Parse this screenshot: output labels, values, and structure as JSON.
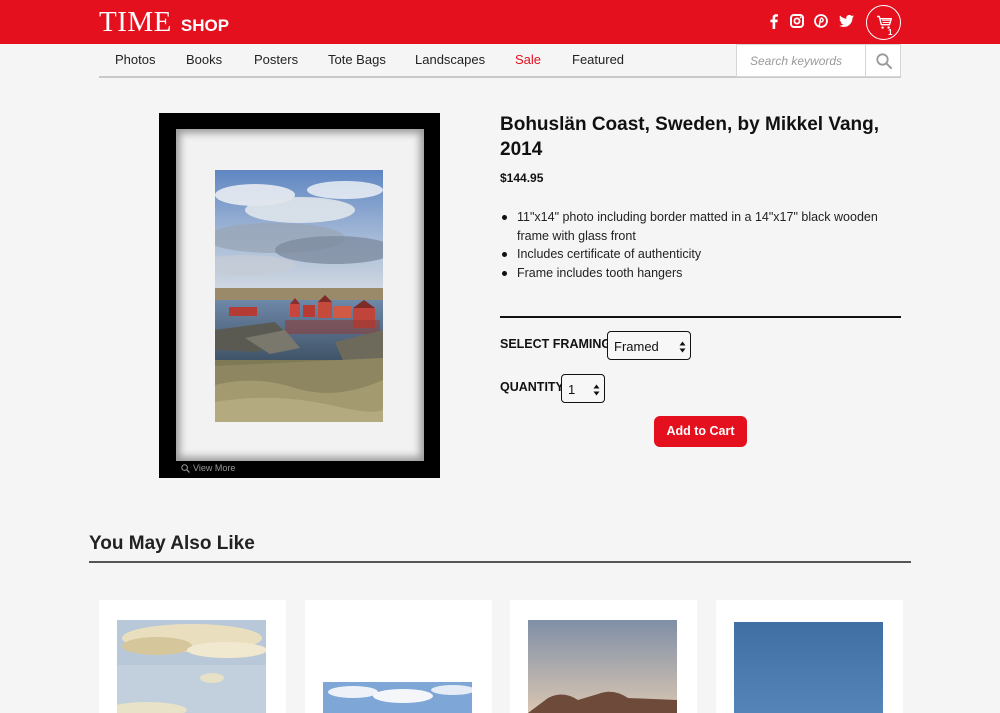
{
  "header": {
    "logo_main": "TIME",
    "logo_sub": "SHOP",
    "social_icons": [
      "facebook-icon",
      "instagram-icon",
      "pinterest-icon",
      "twitter-icon"
    ],
    "cart_count": "1",
    "brand_color": "#e4101e"
  },
  "nav": {
    "items": [
      "Photos",
      "Books",
      "Posters",
      "Tote Bags",
      "Landscapes",
      "Sale",
      "Featured"
    ],
    "sale_color": "#e4101e"
  },
  "search": {
    "placeholder": "Search keywords",
    "icon": "search-icon"
  },
  "product": {
    "view_more": "View More",
    "title": "Bohuslän Coast, Sweden, by Mikkel Vang, 2014",
    "price": "$144.95",
    "features": [
      "11\"x14\" photo including border matted in a 14\"x17\" black wooden frame with glass front",
      "Includes certificate of authenticity",
      "Frame includes tooth hangers"
    ],
    "framing_label": "SELECT FRAMING",
    "framing_value": "Framed",
    "quantity_label": "QUANTITY",
    "quantity_value": "1",
    "add_to_cart": "Add to Cart"
  },
  "related": {
    "title": "You May Also Like"
  }
}
